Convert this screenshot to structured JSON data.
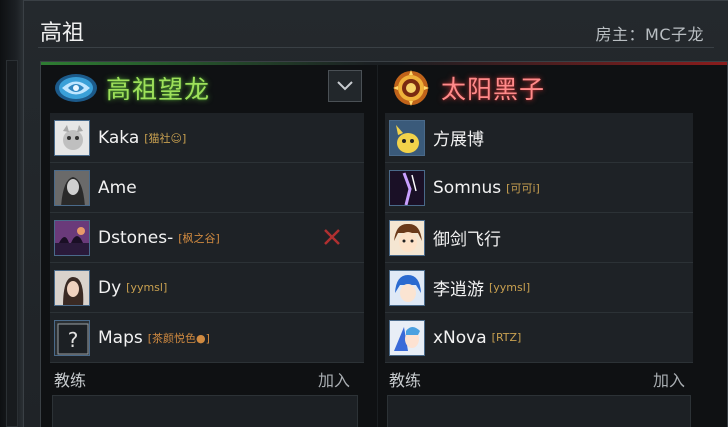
{
  "lobby": {
    "title": "高祖",
    "owner_label": "房主：MC子龙"
  },
  "radiant": {
    "name": "高祖望龙",
    "players": [
      {
        "name": "Kaka",
        "tag": "[猫社☺]"
      },
      {
        "name": "Ame",
        "tag": ""
      },
      {
        "name": "Dstones-",
        "tag": "[枫之谷]"
      },
      {
        "name": "Dy",
        "tag": "[yymsl]"
      },
      {
        "name": "Maps",
        "tag": "[茶颜悦色●]"
      }
    ],
    "coach_label": "教练",
    "join_label": "加入"
  },
  "dire": {
    "name": "太阳黑子",
    "players": [
      {
        "name": "方展博",
        "tag": ""
      },
      {
        "name": "Somnus",
        "tag": "[可可i]"
      },
      {
        "name": "御剑飞行",
        "tag": ""
      },
      {
        "name": "李逍游",
        "tag": "[yymsl]"
      },
      {
        "name": "xNova",
        "tag": "[RTZ]"
      }
    ],
    "coach_label": "教练",
    "join_label": "加入"
  },
  "colors": {
    "radiant_accent": "#9ee05a",
    "dire_accent": "#ff8a8a",
    "kick_icon": "#b03030",
    "tag": "#c8a050"
  },
  "icons": [
    "radiant-logo-icon",
    "dire-logo-icon",
    "chevron-down-icon",
    "close-icon",
    "unknown-avatar-icon"
  ]
}
